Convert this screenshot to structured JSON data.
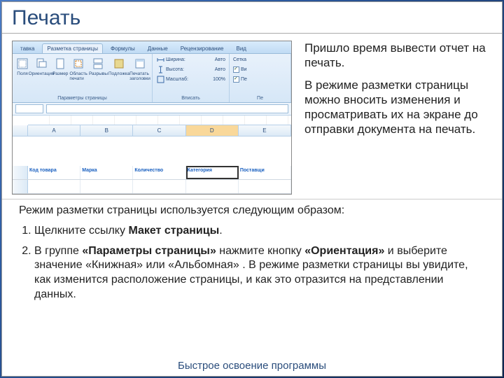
{
  "title": "Печать",
  "side": {
    "p1": "Пришло время вывести отчет на печать.",
    "p2": "В режиме разметки страницы можно вносить изменения и просматривать их на экране до отправки документа на печать."
  },
  "lower": {
    "intro": "Режим разметки страницы используется следующим образом:",
    "step1_a": "Щелкните ссылку ",
    "step1_b": "Макет страницы",
    "step1_c": ".",
    "step2_a": "В группе ",
    "step2_b": "«Параметры страницы»",
    "step2_c": " нажмите кнопку ",
    "step2_d": "«Ориентация»",
    "step2_e": " и выберите значение «Книжная» или «Альбомная» . В режиме разметки страницы вы увидите, как изменится расположение страницы, и как это отразится на представлении данных."
  },
  "footer": "Быстрое освоение программы",
  "tabs": {
    "t1": "тавка",
    "t2": "Разметка страницы",
    "t3": "Формулы",
    "t4": "Данные",
    "t5": "Рецензирование",
    "t6": "Вид"
  },
  "ribbon": {
    "margins": "Поля",
    "orient": "Ориентация",
    "size": "Размер",
    "area": "Область печати",
    "breaks": "Разрывы",
    "bg": "Подложка",
    "titles": "Печатать заголовки",
    "group_page": "Параметры страницы",
    "width": "Ширина:",
    "height": "Высота:",
    "scale": "Масштаб:",
    "auto": "Авто",
    "hundred": "100%",
    "group_fit": "Вписать",
    "grid": "Сетка",
    "group_sheet": "Пе",
    "view": "Ви"
  },
  "cols": {
    "A": "A",
    "B": "B",
    "C": "C",
    "D": "D",
    "E": "E"
  },
  "cells": {
    "A": "Код товара",
    "B": "Марка",
    "C": "Количество",
    "D": "Категория",
    "E": "Поставщи"
  }
}
